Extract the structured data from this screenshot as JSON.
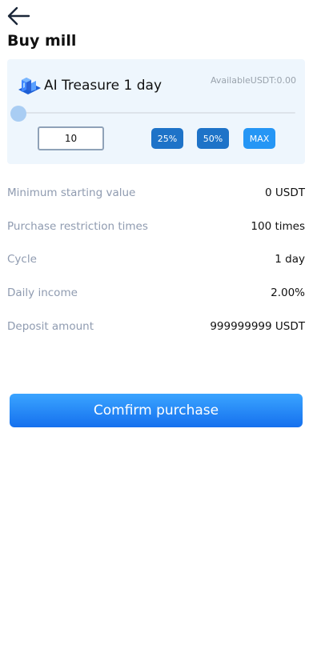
{
  "header": {
    "title": "Buy mill",
    "back_icon": "arrow-left-icon"
  },
  "product": {
    "icon": "mill-machine-icon",
    "name": "AI Treasure 1 day",
    "available": "AvailableUSDT:0.00"
  },
  "purchase": {
    "slider_fraction": 0,
    "quantity": "10",
    "quick_buttons": {
      "p25": "25%",
      "p50": "50%",
      "max": "MAX"
    }
  },
  "details": [
    {
      "label": "Minimum starting value",
      "value": "0 USDT"
    },
    {
      "label": "Purchase restriction times",
      "value": "100 times"
    },
    {
      "label": "Cycle",
      "value": "1 day"
    },
    {
      "label": "Daily income",
      "value": "2.00%"
    },
    {
      "label": "Deposit amount",
      "value": "999999999 USDT"
    }
  ],
  "confirm_label": "Comfirm purchase",
  "colors": {
    "accent": "#1e73c8",
    "card_bg": "#eef6fd",
    "label_gray": "#8f9bb0"
  }
}
